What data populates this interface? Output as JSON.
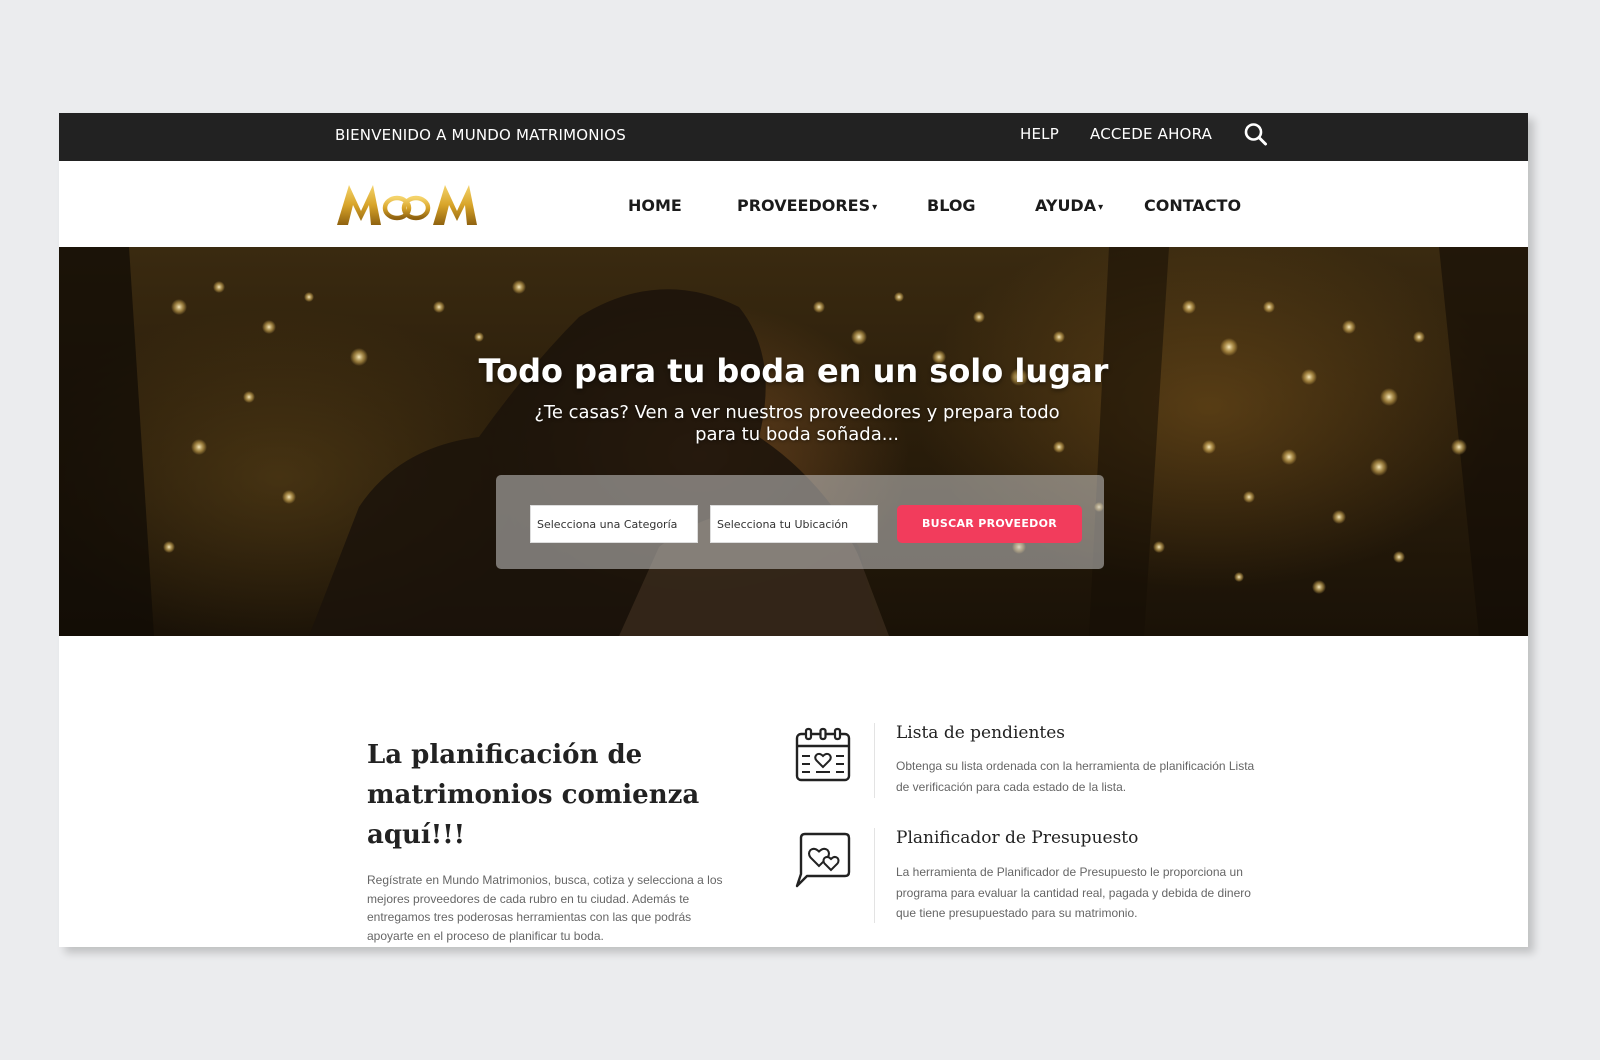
{
  "topbar": {
    "welcome": "BIENVENIDO A MUNDO MATRIMONIOS",
    "help": "HELP",
    "login": "ACCEDE AHORA",
    "search_icon": "search-icon"
  },
  "logo": {
    "text": "MOOM",
    "colors": {
      "gold": "#d8a429",
      "gold_light": "#f4d36a",
      "gold_dark": "#8f6210"
    }
  },
  "nav": {
    "items": [
      {
        "label": "HOME",
        "dropdown": false
      },
      {
        "label": "PROVEEDORES",
        "dropdown": true
      },
      {
        "label": "BLOG",
        "dropdown": false
      },
      {
        "label": "AYUDA",
        "dropdown": true
      },
      {
        "label": "CONTACTO",
        "dropdown": false
      }
    ],
    "caret": "▾"
  },
  "hero": {
    "title": "Todo para tu boda en un solo lugar",
    "subtitle": "¿Te casas? Ven a ver nuestros proveedores y prepara todo para tu boda soñada...",
    "search": {
      "category_value": "Selecciona una Categoría",
      "location_value": "Selecciona tu Ubicación",
      "button_label": "BUSCAR PROVEEDOR"
    }
  },
  "intro": {
    "title": "La planificación de matrimonios comienza aquí!!!",
    "text": "Regístrate en Mundo Matrimonios, busca, cotiza y selecciona a los mejores proveedores de cada rubro en tu ciudad. Además te entregamos tres poderosas herramientas con las que podrás apoyarte en el proceso de planificar tu boda."
  },
  "features": [
    {
      "icon": "calendar-heart-icon",
      "title": "Lista de pendientes",
      "text": "Obtenga su lista ordenada con la herramienta de planificación Lista de verificación para cada estado de la lista."
    },
    {
      "icon": "chat-hearts-icon",
      "title": "Planificador de Presupuesto",
      "text": "La herramienta de Planificador de Presupuesto le proporciona un programa para evaluar la cantidad real, pagada y debida de dinero que tiene presupuestado para su matrimonio."
    }
  ],
  "colors": {
    "topbar_bg": "#222222",
    "accent": "#f23c5c",
    "text_dark": "#222222",
    "text_muted": "#666666"
  }
}
